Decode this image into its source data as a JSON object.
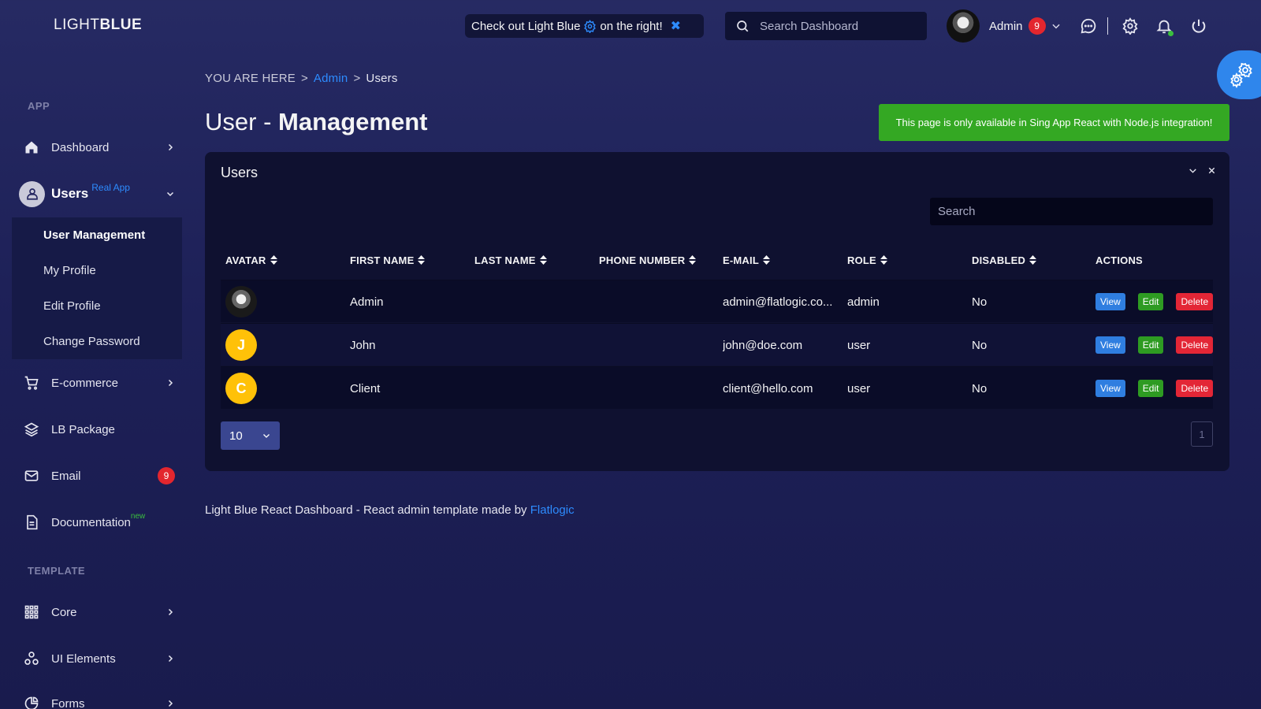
{
  "logo": {
    "light": "LIGHT",
    "bold": "BLUE"
  },
  "promo": {
    "text_before": "Check out Light Blue",
    "text_after": "on the right!"
  },
  "header": {
    "search_placeholder": "Search Dashboard",
    "user_name": "Admin",
    "notifications": "9"
  },
  "sidebar": {
    "section_app": "APP",
    "section_template": "TEMPLATE",
    "dashboard": "Dashboard",
    "users": {
      "label": "Users",
      "sup": "Real App"
    },
    "submenu": [
      "User Management",
      "My Profile",
      "Edit Profile",
      "Change Password"
    ],
    "ecommerce": "E-commerce",
    "lb_package": "LB Package",
    "email": {
      "label": "Email",
      "badge": "9"
    },
    "documentation": {
      "label": "Documentation",
      "sup": "new"
    },
    "core": "Core",
    "ui_elements": "UI Elements",
    "forms": "Forms"
  },
  "breadcrumb": {
    "prefix": "YOU ARE HERE",
    "sep": ">",
    "admin": "Admin",
    "current": "Users"
  },
  "page_title": {
    "light": "User - ",
    "bold": "Management"
  },
  "alert": "This page is only available in Sing App React with Node.js integration!",
  "card": {
    "title": "Users",
    "search_placeholder": "Search",
    "columns": [
      "AVATAR",
      "FIRST NAME",
      "LAST NAME",
      "PHONE NUMBER",
      "E-MAIL",
      "ROLE",
      "DISABLED",
      "ACTIONS"
    ],
    "rows": [
      {
        "avatar": "",
        "first": "Admin",
        "last": "",
        "phone": "",
        "email": "admin@flatlogic.co...",
        "role": "admin",
        "disabled": "No"
      },
      {
        "avatar": "J",
        "first": "John",
        "last": "",
        "phone": "",
        "email": "john@doe.com",
        "role": "user",
        "disabled": "No"
      },
      {
        "avatar": "C",
        "first": "Client",
        "last": "",
        "phone": "",
        "email": "client@hello.com",
        "role": "user",
        "disabled": "No"
      }
    ],
    "actions": {
      "view": "View",
      "edit": "Edit",
      "delete": "Delete"
    },
    "page_size": "10",
    "page": "1"
  },
  "footer": {
    "text": "Light Blue React Dashboard - React admin template made by ",
    "link": "Flatlogic"
  },
  "colors": {
    "accent": "#2d8cff",
    "success": "#34a823",
    "danger": "#e32636",
    "avatar_letter_bg": "#ffc108"
  }
}
